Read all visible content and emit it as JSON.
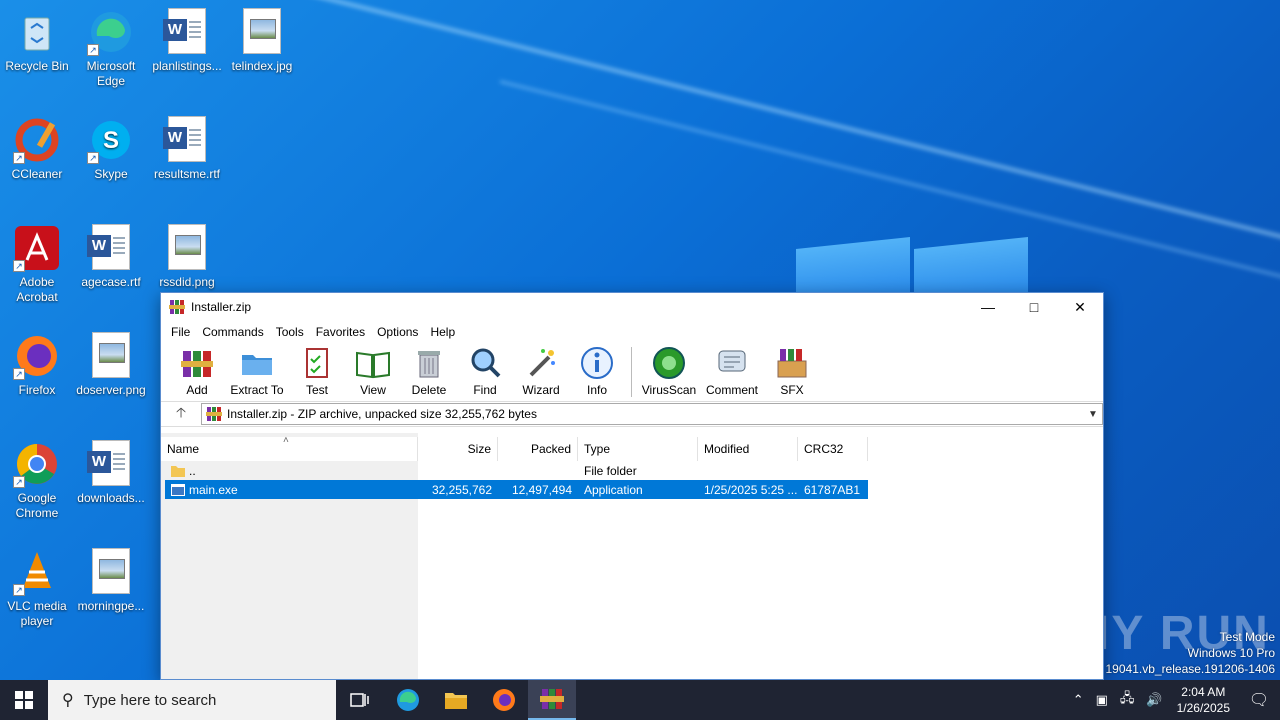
{
  "desktop": {
    "icons": [
      {
        "label": "Recycle Bin"
      },
      {
        "label": "Microsoft Edge"
      },
      {
        "label": "planlistings..."
      },
      {
        "label": "telindex.jpg"
      },
      {
        "label": "CCleaner"
      },
      {
        "label": "Skype"
      },
      {
        "label": "resultsme.rtf"
      },
      {
        "label": "Adobe Acrobat"
      },
      {
        "label": "agecase.rtf"
      },
      {
        "label": "rssdid.png"
      },
      {
        "label": "Firefox"
      },
      {
        "label": "doserver.png"
      },
      {
        "label": "Google Chrome"
      },
      {
        "label": "downloads..."
      },
      {
        "label": "VLC media player"
      },
      {
        "label": "morningpe..."
      }
    ]
  },
  "window": {
    "title": "Installer.zip",
    "menu": [
      "File",
      "Commands",
      "Tools",
      "Favorites",
      "Options",
      "Help"
    ],
    "toolbar": [
      "Add",
      "Extract To",
      "Test",
      "View",
      "Delete",
      "Find",
      "Wizard",
      "Info",
      "VirusScan",
      "Comment",
      "SFX"
    ],
    "address": "Installer.zip - ZIP archive, unpacked size 32,255,762 bytes",
    "columns": [
      "Name",
      "Size",
      "Packed",
      "Type",
      "Modified",
      "CRC32"
    ],
    "rows": [
      {
        "name": "..",
        "size": "",
        "packed": "",
        "type": "File folder",
        "modified": "",
        "crc": ""
      },
      {
        "name": "main.exe",
        "size": "32,255,762",
        "packed": "12,497,494",
        "type": "Application",
        "modified": "1/25/2025 5:25 ...",
        "crc": "61787AB1"
      }
    ]
  },
  "watermark": {
    "brand": "ANY RUN",
    "mode": "Test Mode",
    "edition": "Windows 10 Pro",
    "build": "ild 19041.vb_release.191206-1406"
  },
  "taskbar": {
    "search_placeholder": "Type here to search",
    "time": "2:04 AM",
    "date": "1/26/2025"
  },
  "colors": {
    "accent": "#0078d7",
    "taskbar": "#1f2433"
  }
}
